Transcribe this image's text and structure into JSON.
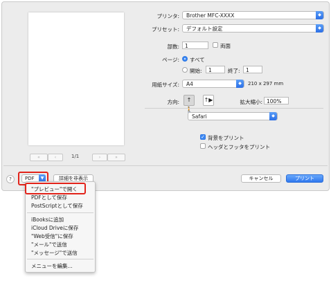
{
  "pager": {
    "first": "«",
    "prev": "‹",
    "next": "›",
    "last": "»",
    "count": "1/1"
  },
  "settings": {
    "printer": {
      "label": "プリンタ:",
      "value": "Brother MFC-XXXX"
    },
    "preset": {
      "label": "プリセット:",
      "value": "デフォルト設定"
    },
    "copies": {
      "label": "部数:",
      "value": "1",
      "duplex_label": "両面"
    },
    "pages": {
      "label": "ページ:",
      "all_label": "すべて",
      "from_label": "開始:",
      "from_value": "1",
      "to_label": "終了:",
      "to_value": "1"
    },
    "paper_size": {
      "label": "用紙サイズ:",
      "value": "A4",
      "dimensions": "210 x 297 mm"
    },
    "orientation": {
      "label": "方向:",
      "portrait_glyph": "↑🚶",
      "landscape_glyph": "↑▶"
    },
    "scale": {
      "label": "拡大縮小:",
      "value": "100%"
    },
    "app_section": {
      "value": "Safari"
    },
    "background": {
      "label": "背景をプリント",
      "checked": true
    },
    "headers": {
      "label": "ヘッダとフッタをプリント",
      "checked": false
    }
  },
  "footer": {
    "help": "?",
    "pdf": "PDF",
    "hide_details": "詳細を非表示",
    "cancel": "キャンセル",
    "print": "プリント"
  },
  "pdf_menu": {
    "items": [
      "\"プレビュー\"で開く",
      "PDFとして保存",
      "PostScriptとして保存",
      "iBooksに追加",
      "iCloud Driveに保存",
      "\"Web受信\"に保存",
      "\"メール\"で送信",
      "\"メッセージ\"で送信",
      "メニューを編集..."
    ]
  },
  "colors": {
    "accent": "#3b87f3",
    "highlight": "#e2231a"
  }
}
